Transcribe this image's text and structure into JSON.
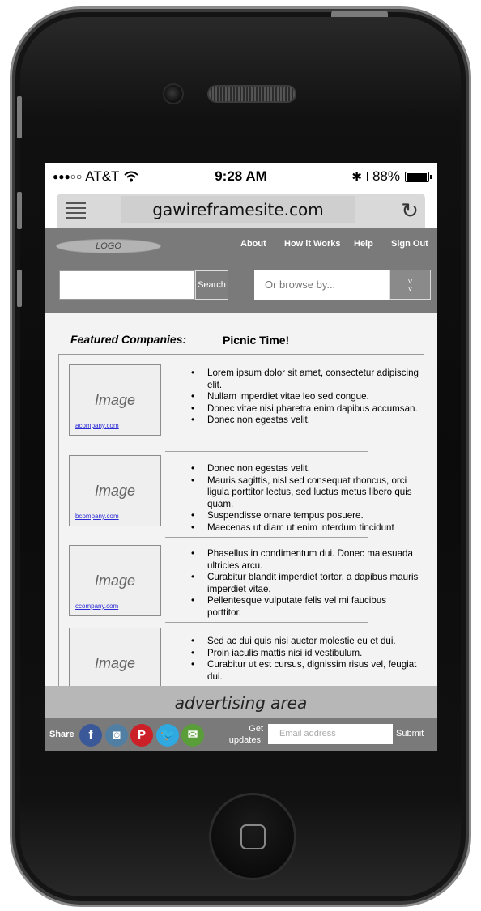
{
  "status_bar": {
    "signal_dots": "●●●○○",
    "carrier": "AT&T",
    "wifi_icon": "wifi-icon",
    "time": "9:28 AM",
    "bluetooth": "✱",
    "battery_percent": "88%",
    "battery_level": 0.88
  },
  "browser": {
    "url": "gawireframesite.com",
    "menu_icon": "hamburger-icon",
    "reload_icon": "↻"
  },
  "nav": {
    "logo": "LOGO",
    "links": [
      "About",
      "How it Works",
      "Help",
      "Sign Out"
    ],
    "search_button": "Search",
    "browse_placeholder": "Or browse by...",
    "browse_arrow": "˅˅"
  },
  "content": {
    "featured_label": "Featured Companies:",
    "picnic_label": "Picnic Time!",
    "companies": [
      {
        "image_text": "Image",
        "link": "acompany.com",
        "bullets": [
          "Lorem ipsum dolor sit amet, consectetur adipiscing elit.",
          "Nullam imperdiet vitae leo sed congue.",
          "Donec vitae nisi pharetra enim dapibus accumsan.",
          "Donec non egestas velit."
        ]
      },
      {
        "image_text": "Image",
        "link": "bcompany.com",
        "bullets": [
          "Donec non egestas velit.",
          "Mauris sagittis, nisl sed consequat rhoncus, orci ligula porttitor lectus, sed luctus metus libero quis quam.",
          "Suspendisse ornare tempus posuere.",
          "Maecenas ut diam ut enim interdum tincidunt"
        ]
      },
      {
        "image_text": "Image",
        "link": "ccompany.com",
        "bullets": [
          "Phasellus in condimentum dui. Donec malesuada ultricies arcu.",
          "Curabitur blandit imperdiet tortor, a dapibus mauris imperdiet vitae.",
          "Pellentesque vulputate felis vel mi faucibus porttitor."
        ]
      },
      {
        "image_text": "Image",
        "link": "",
        "bullets": [
          "Sed ac dui quis nisi auctor molestie eu et dui.",
          "Proin iaculis mattis nisi id vestibulum.",
          "Curabitur ut est cursus, dignissim risus vel, feugiat dui."
        ]
      }
    ]
  },
  "advertising": "advertising area",
  "footer": {
    "share_label": "Share",
    "social": [
      {
        "name": "facebook-icon",
        "glyph": "f",
        "color": "#3b5998"
      },
      {
        "name": "instagram-icon",
        "glyph": "◙",
        "color": "#517fa4"
      },
      {
        "name": "pinterest-icon",
        "glyph": "P",
        "color": "#cb2027"
      },
      {
        "name": "twitter-icon",
        "glyph": "🐦",
        "color": "#2fa9e0"
      },
      {
        "name": "email-icon",
        "glyph": "✉",
        "color": "#5a9e3a"
      }
    ],
    "get_updates": "Get updates:",
    "email_placeholder": "Email address",
    "submit": "Submit"
  }
}
